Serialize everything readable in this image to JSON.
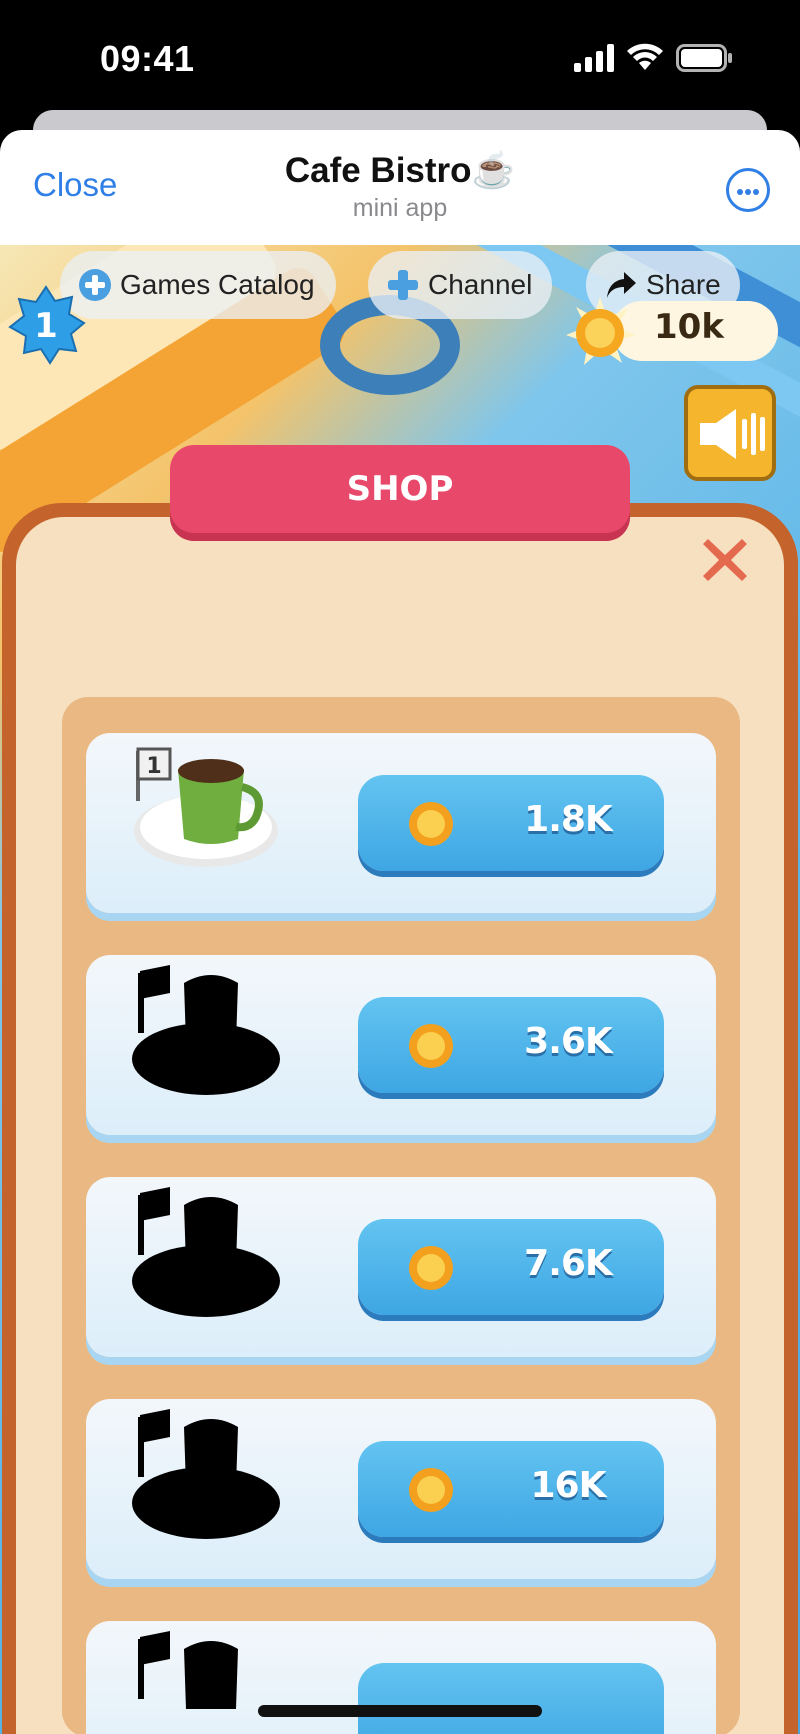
{
  "status_bar": {
    "time": "09:41"
  },
  "header": {
    "close_label": "Close",
    "title": "Cafe Bistro☕",
    "subtitle": "mini app"
  },
  "toolbar": {
    "games_catalog_label": "Games Catalog",
    "channel_label": "Channel",
    "share_label": "Share"
  },
  "hud": {
    "level": "1",
    "coins": "10k"
  },
  "shop": {
    "title": "SHOP",
    "items": [
      {
        "price": "1.8K",
        "unlocked": true,
        "image": "green-coffee-cup-icon",
        "table_number": "1"
      },
      {
        "price": "3.6K",
        "unlocked": false,
        "image": "locked-silhouette-icon"
      },
      {
        "price": "7.6K",
        "unlocked": false,
        "image": "locked-silhouette-icon"
      },
      {
        "price": "16K",
        "unlocked": false,
        "image": "locked-silhouette-icon"
      }
    ]
  },
  "colors": {
    "accent_blue": "#2f7fe6",
    "shop_title_bg": "#e8496a",
    "buy_button": "#3ea6e3",
    "panel_bg": "#f7e0bf"
  }
}
